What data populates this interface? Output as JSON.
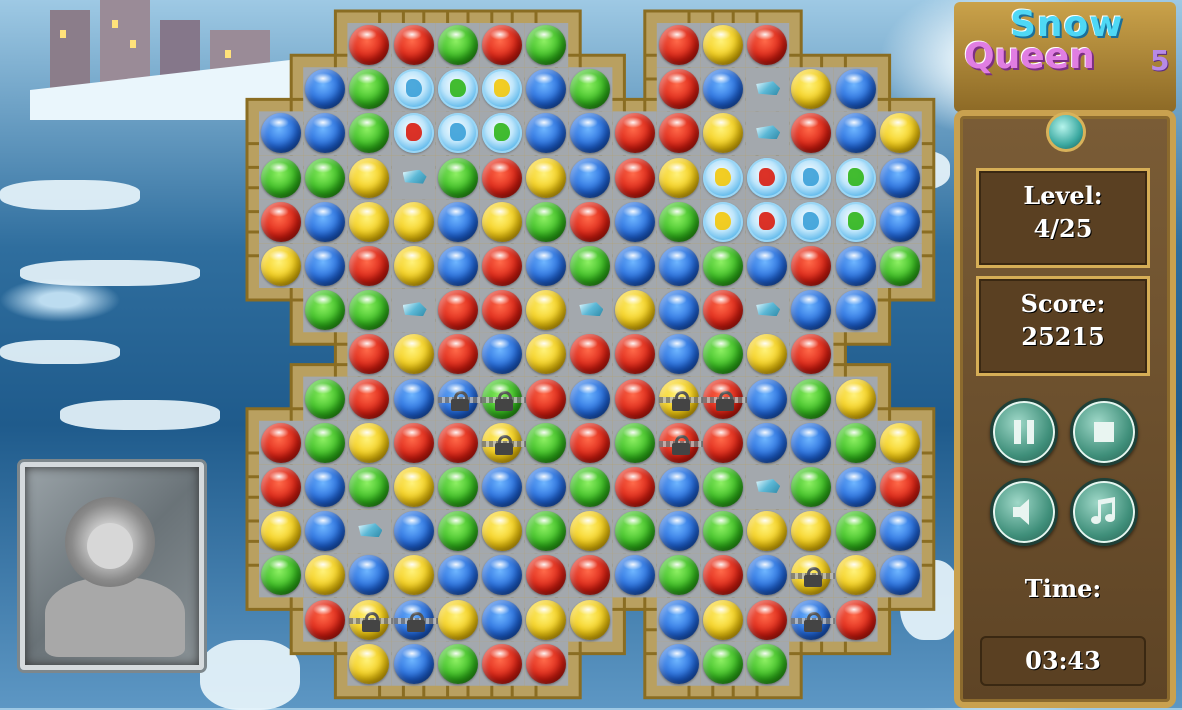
{
  "game": {
    "title_line1": "Snow",
    "title_line2": "Queen",
    "title_number": "5"
  },
  "hud": {
    "level_label": "Level:",
    "level_value": "4/25",
    "score_label": "Score:",
    "score_value": "25215",
    "time_label": "Time:",
    "time_value": "03:43"
  },
  "buttons": {
    "pause_icon": "pause-icon",
    "stop_icon": "stop-icon",
    "sound_icon": "speaker-mute-icon",
    "music_icon": "music-note-icon"
  },
  "colors": {
    "red": "#d81c10",
    "green": "#2fb51a",
    "blue": "#1d63d8",
    "yellow": "#f2c80c",
    "frame_gold": "#c9a14f",
    "cell_gray": "#9ea3a8"
  },
  "board": {
    "legend": "R=red G=green B=blue Y=yellow F=frozen ball, s=ice shard, L=locked (lowercase color after L), .=empty",
    "rows": [
      ". . R R G R G . . R Y R . .",
      ". B G F F F B G . R B s Y B",
      "B B G F F F B B R R Y s R B Y",
      "G G Y s G R Y B R Y F F F F B",
      "R B Y Y B Y G R B G F F F F B",
      "Y B R Y B R B G B B G B R B G",
      ". G G s R R Y s Y B R s B B .",
      ". . R Y R B Y R R B G Y R . .",
      ". G R B Lb Lg R B R Ly Lr B G Y .",
      "R G Y R R Ly G R G Lr R B B G Y",
      "R B G Y G B B G R B G s G B R",
      "Y B s B G Y G Y G B G Y Y G B",
      "G Y B Y B B R R B G R B Ly Y B",
      ". R Ly Lb Y B Y Y . B Y R Lb R .",
      ". . Y B G R R . . B G G . . ."
    ]
  }
}
